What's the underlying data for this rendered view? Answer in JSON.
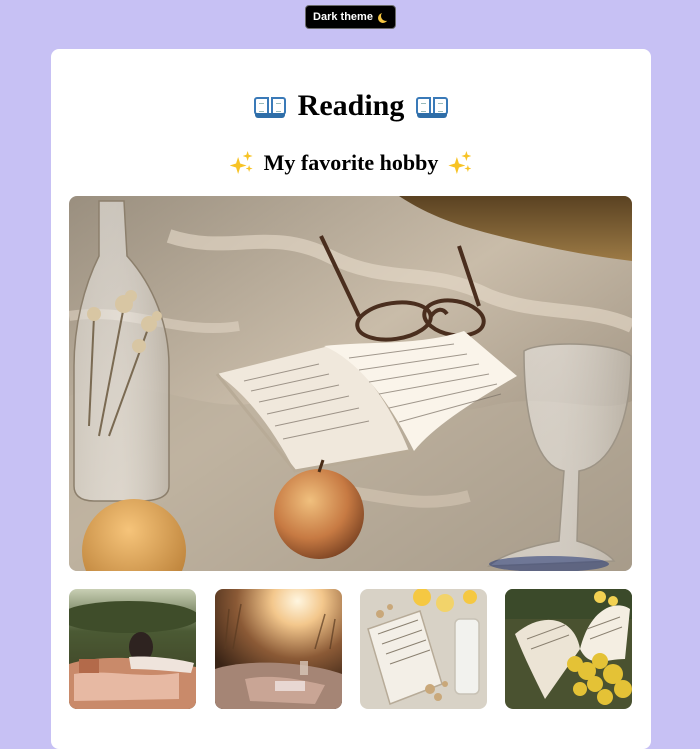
{
  "theme_toggle": {
    "label": "Dark theme",
    "icon": "moon-icon"
  },
  "page": {
    "title": "Reading",
    "title_icon": "book-icon",
    "subtitle": "My favorite hobby",
    "subtitle_icon": "sparkles-icon"
  },
  "images": {
    "hero": "photo-open-book-glasses-picnic",
    "thumbnails": [
      "photo-person-lying-picnic-blanket",
      "photo-sunset-picnic-blanket",
      "photo-book-lemons-flowers",
      "photo-open-book-yellow-flowers"
    ]
  },
  "colors": {
    "page_background": "#c7c1f4",
    "card_background": "#ffffff",
    "button_background": "#000000"
  }
}
